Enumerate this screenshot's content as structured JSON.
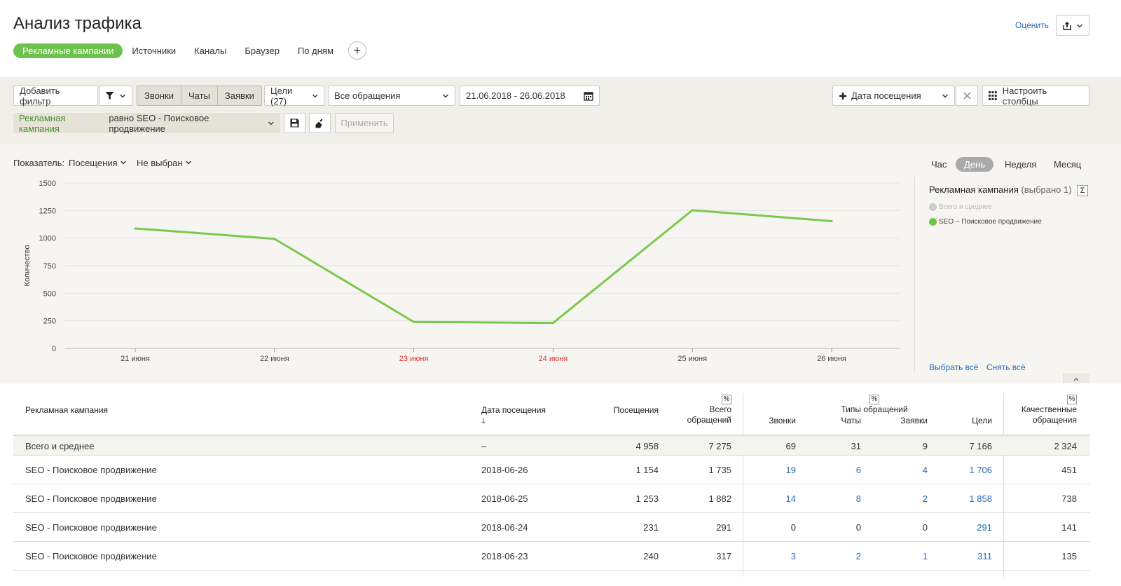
{
  "header": {
    "title": "Анализ трафика",
    "tabs": [
      "Рекламные кампании",
      "Источники",
      "Каналы",
      "Браузер",
      "По дням"
    ],
    "rate_label": "Оценить"
  },
  "filters": {
    "add_filter": "Добавить фильтр",
    "types": [
      "Звонки",
      "Чаты",
      "Заявки"
    ],
    "goals": "Цели (27)",
    "requests": "Все обращения",
    "date_range": "21.06.2018 - 26.06.2018",
    "visit_date": "Дата посещения",
    "configure_columns": "Настроить столбцы",
    "chip_key": "Рекламная кампания",
    "chip_value": "равно SEO - Поисковое продвижение",
    "apply": "Применить"
  },
  "chart_controls": {
    "metric_label": "Показатель:",
    "metric_value": "Посещения",
    "metric_second": "Не выбран",
    "periods": [
      "Час",
      "День",
      "Неделя",
      "Месяц"
    ],
    "active_period": "День"
  },
  "legend": {
    "title": "Рекламная кампания",
    "subtitle": "(выбрано 1)",
    "sigma": "Σ",
    "items": [
      {
        "label": "Всего и среднее",
        "color": "#cccccc",
        "muted": true
      },
      {
        "label": "SEO – Поисковое продвижение",
        "color": "#6cc24a",
        "muted": false
      }
    ],
    "select_all": "Выбрать всё",
    "deselect_all": "Снять всё"
  },
  "chart_data": {
    "type": "line",
    "x": [
      "21 июня",
      "22 июня",
      "23 июня",
      "24 июня",
      "25 июня",
      "26 июня"
    ],
    "weekend": [
      false,
      false,
      true,
      true,
      false,
      false
    ],
    "series": [
      {
        "name": "SEO – Поисковое продвижение",
        "values": [
          1088,
          993,
          240,
          231,
          1253,
          1154
        ],
        "color": "#7bc94c"
      }
    ],
    "ylabel": "Количество",
    "yticks": [
      0,
      250,
      500,
      750,
      1000,
      1250,
      1500
    ],
    "ylim": [
      0,
      1500
    ],
    "grid": true
  },
  "table": {
    "headers": {
      "campaign": "Рекламная кампания",
      "visit_date": "Дата посещения",
      "visits": "Посещения",
      "total_req_1": "Всего",
      "total_req_2": "обращений",
      "types_group": "Типы обращений",
      "calls": "Звонки",
      "chats": "Чаты",
      "requests": "Заявки",
      "goals": "Цели",
      "quality_1": "Качественные",
      "quality_2": "обращения",
      "pct": "%",
      "sort_arrow": "🡓"
    },
    "total": {
      "campaign": "Всего и среднее",
      "date": "–",
      "visits": "4 958",
      "total_req": "7 275",
      "calls": "69",
      "chats": "31",
      "requests": "9",
      "goals": "7 166",
      "quality": "2 324"
    },
    "rows": [
      {
        "campaign": "SEO - Поисковое продвижение",
        "date": "2018-06-26",
        "visits": "1 154",
        "total_req": "1 735",
        "calls": "19",
        "chats": "6",
        "requests": "4",
        "goals": "1 706",
        "quality": "451"
      },
      {
        "campaign": "SEO - Поисковое продвижение",
        "date": "2018-06-25",
        "visits": "1 253",
        "total_req": "1 882",
        "calls": "14",
        "chats": "8",
        "requests": "2",
        "goals": "1 858",
        "quality": "738"
      },
      {
        "campaign": "SEO - Поисковое продвижение",
        "date": "2018-06-24",
        "visits": "231",
        "total_req": "291",
        "calls": "0",
        "chats": "0",
        "requests": "0",
        "goals": "291",
        "quality": "141"
      },
      {
        "campaign": "SEO - Поисковое продвижение",
        "date": "2018-06-23",
        "visits": "240",
        "total_req": "317",
        "calls": "3",
        "chats": "2",
        "requests": "1",
        "goals": "311",
        "quality": "135"
      }
    ]
  }
}
